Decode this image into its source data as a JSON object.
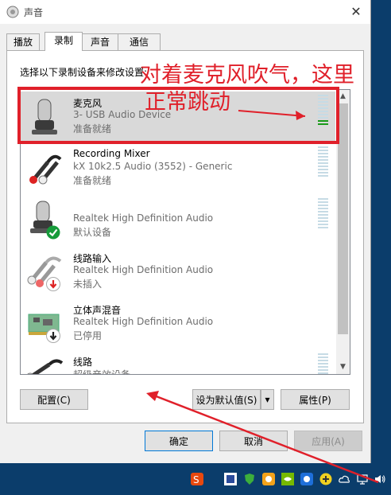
{
  "window": {
    "title": "声音",
    "close_glyph": "✕"
  },
  "tabs": [
    {
      "label": "播放",
      "active": false
    },
    {
      "label": "录制",
      "active": true
    },
    {
      "label": "声音",
      "active": false
    },
    {
      "label": "通信",
      "active": false
    }
  ],
  "instruction": "选择以下录制设备来修改设置:",
  "devices": [
    {
      "name": "麦克风",
      "description": "3- USB Audio Device",
      "status": "准备就绪",
      "icon": "microphone-icon",
      "selected": true,
      "meter_level": 0.2
    },
    {
      "name": "Recording Mixer",
      "description": "kX 10k2.5 Audio (3552) - Generic",
      "status": "准备就绪",
      "icon": "rca-cable-icon",
      "selected": false,
      "meter_level": 0
    },
    {
      "name": "",
      "description": "Realtek High Definition Audio",
      "status": "默认设备",
      "icon": "microphone-icon",
      "badge": "default-check-icon",
      "selected": false,
      "meter_level": 0
    },
    {
      "name": "线路输入",
      "description": "Realtek High Definition Audio",
      "status": "未插入",
      "icon": "rca-cable-icon",
      "badge": "unplugged-arrow-icon",
      "selected": false,
      "meter_level": 0
    },
    {
      "name": "立体声混音",
      "description": "Realtek High Definition Audio",
      "status": "已停用",
      "icon": "sound-card-icon",
      "badge": "disabled-arrow-icon",
      "selected": false,
      "meter_level": 0
    },
    {
      "name": "线路",
      "description": "超级音效设备",
      "status": "",
      "icon": "cable-icon",
      "selected": false,
      "meter_level": 0
    }
  ],
  "buttons": {
    "configure": "配置(C)",
    "set_default": "设为默认值(S)",
    "properties": "属性(P)",
    "ok": "确定",
    "cancel": "取消",
    "apply": "应用(A)"
  },
  "annotation": {
    "line1": "对着麦克风吹气，这里",
    "line2": "正常跳动"
  },
  "colors": {
    "annotation_red": "#e0202a",
    "meter_green": "#1a9a1a",
    "meter_idle": "#c6dbe5",
    "selection": "#d9d9d9"
  }
}
